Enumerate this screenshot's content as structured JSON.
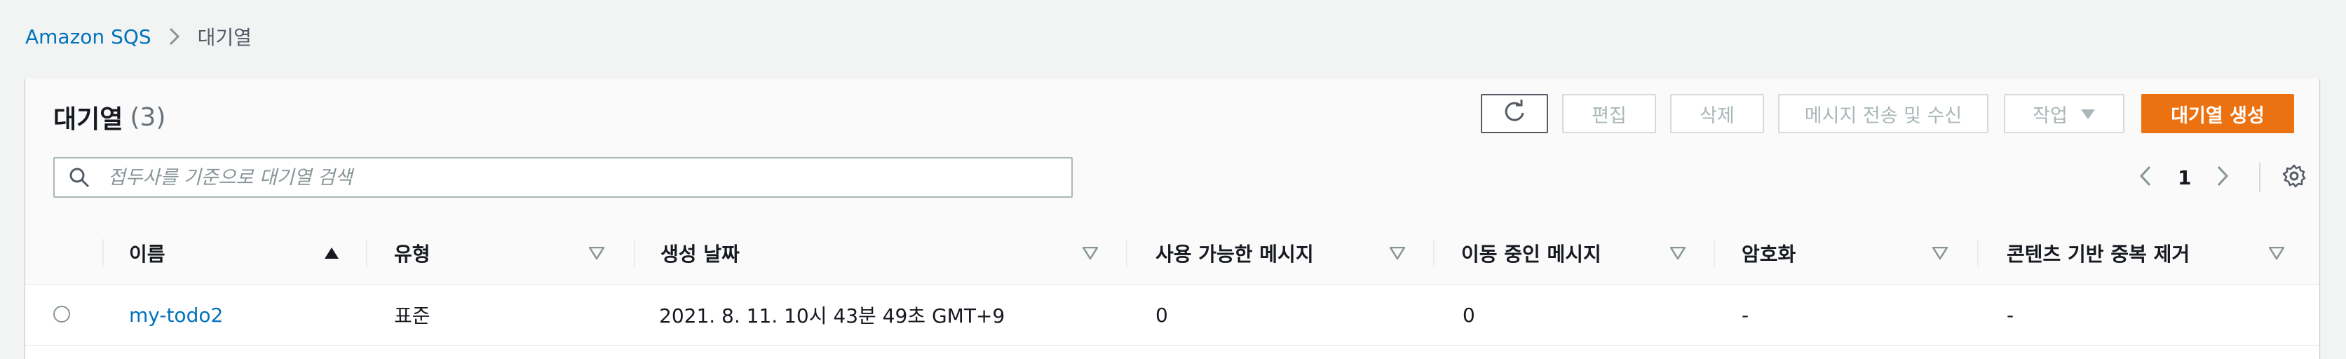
{
  "breadcrumb": {
    "items": [
      "Amazon SQS",
      "대기열"
    ]
  },
  "panel": {
    "title": "대기열",
    "count": "(3)"
  },
  "toolbar": {
    "refresh_icon": "refresh-icon",
    "edit_label": "편집",
    "delete_label": "삭제",
    "send_receive_label": "메시지 전송 및 수신",
    "actions_label": "작업",
    "create_label": "대기열 생성"
  },
  "search": {
    "placeholder": "접두사를 기준으로 대기열 검색",
    "value": ""
  },
  "pagination": {
    "current_page": "1"
  },
  "table": {
    "columns": [
      "이름",
      "유형",
      "생성 날짜",
      "사용 가능한 메시지",
      "이동 중인 메시지",
      "암호화",
      "콘텐츠 기반 중복 제거"
    ],
    "sorted_column": "이름",
    "sort_direction": "ascending",
    "rows": [
      {
        "name": "my-todo2",
        "type": "표준",
        "created": "2021. 8. 11. 10시 43분 49초 GMT+9",
        "available": "0",
        "in_flight": "0",
        "encryption": "-",
        "dedup": "-"
      }
    ]
  },
  "colors": {
    "accent": "#ec7211",
    "link": "#0073bb"
  }
}
